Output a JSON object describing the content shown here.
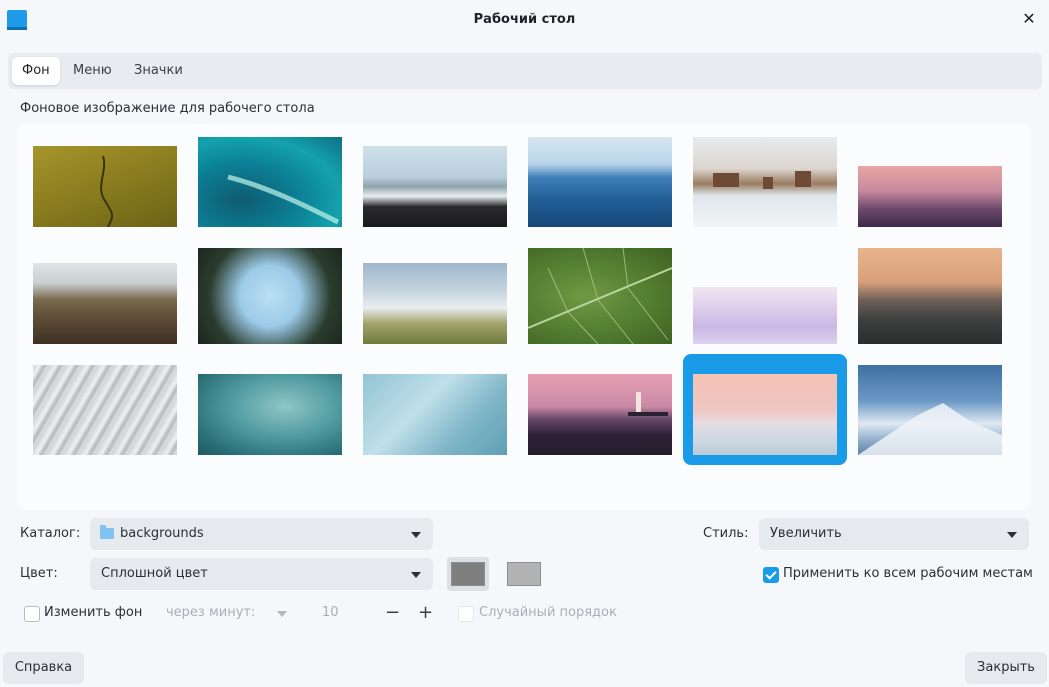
{
  "window": {
    "title": "Рабочий стол"
  },
  "tabs": [
    {
      "label": "Фон",
      "active": true
    },
    {
      "label": "Меню",
      "active": false
    },
    {
      "label": "Значки",
      "active": false
    }
  ],
  "background": {
    "heading": "Фоновое изображение для рабочего стола",
    "selected_index": 16,
    "thumbnails": [
      "yellow-plain-crack",
      "teal-aurora",
      "black-sand-beach",
      "calm-sea",
      "monument-valley-snow",
      "pink-city-skyline",
      "canyon-waterfall",
      "palm-trees-sky",
      "misty-valley-hills",
      "green-leaf-macro",
      "pink-cloud-haze",
      "sunset-mountains",
      "metal-scales-texture",
      "teal-ice-water",
      "teal-abstract-waves",
      "lighthouse-dusk",
      "pink-sand-dune",
      "snowy-peak"
    ]
  },
  "controls": {
    "catalog_label": "Каталог:",
    "catalog_value": "backgrounds",
    "style_label": "Стиль:",
    "style_value": "Увеличить",
    "color_label": "Цвет:",
    "color_value": "Сплошной цвет",
    "primary_color": "#7f7f7f",
    "secondary_color": "#b3b3b3",
    "apply_all_label": "Применить ко всем рабочим местам",
    "apply_all_checked": true,
    "change_bg_label": "Изменить фон",
    "change_bg_checked": false,
    "interval_label": "через минут:",
    "interval_value": "10",
    "minus": "−",
    "plus": "+",
    "random_order_label": "Случайный порядок"
  },
  "buttons": {
    "help": "Справка",
    "close": "Закрыть"
  },
  "colors": {
    "accent": "#1a9be8"
  }
}
